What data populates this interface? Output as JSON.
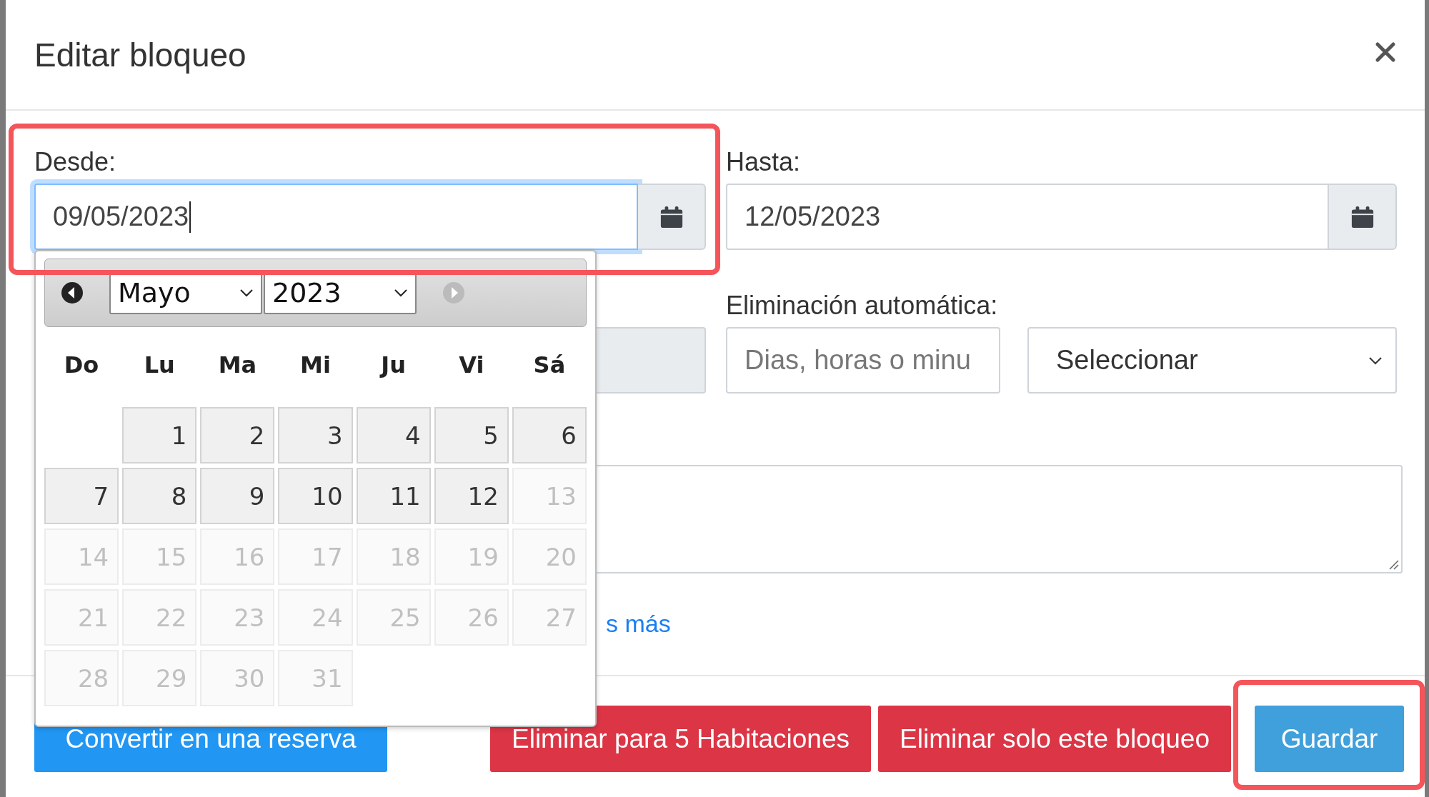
{
  "dialog": {
    "title": "Editar bloqueo"
  },
  "date_fields": [
    {
      "label": "Desde:",
      "value": "09/05/2023",
      "focused": true,
      "highlighted": true
    },
    {
      "label": "Hasta:",
      "value": "12/05/2023",
      "focused": false,
      "highlighted": false
    }
  ],
  "auto_delete": {
    "label": "Eliminación automática:",
    "amount": {
      "placeholder": "Dias, horas o minu"
    },
    "unit": {
      "value": "Seleccionar"
    }
  },
  "link": {
    "text": "s más"
  },
  "datepicker": {
    "month": "Mayo",
    "year": "2023",
    "prev_disabled": false,
    "next_disabled": true,
    "weekdays": [
      "Do",
      "Lu",
      "Ma",
      "Mi",
      "Ju",
      "Vi",
      "Sá"
    ],
    "weeks": [
      [
        {
          "day": "1",
          "disabled": false
        },
        {
          "day": "2",
          "disabled": false
        },
        {
          "day": "3",
          "disabled": false
        },
        {
          "day": "4",
          "disabled": false
        },
        {
          "day": "5",
          "disabled": false
        },
        {
          "day": "6",
          "disabled": false
        }
      ],
      [
        {
          "day": "7",
          "disabled": false
        },
        {
          "day": "8",
          "disabled": false
        },
        {
          "day": "9",
          "disabled": false
        },
        {
          "day": "10",
          "disabled": false
        },
        {
          "day": "11",
          "disabled": false
        },
        {
          "day": "12",
          "disabled": false
        },
        {
          "day": "13",
          "disabled": true
        }
      ],
      [
        {
          "day": "14",
          "disabled": true
        },
        {
          "day": "15",
          "disabled": true
        },
        {
          "day": "16",
          "disabled": true
        },
        {
          "day": "17",
          "disabled": true
        },
        {
          "day": "18",
          "disabled": true
        },
        {
          "day": "19",
          "disabled": true
        },
        {
          "day": "20",
          "disabled": true
        }
      ],
      [
        {
          "day": "21",
          "disabled": true
        },
        {
          "day": "22",
          "disabled": true
        },
        {
          "day": "23",
          "disabled": true
        },
        {
          "day": "24",
          "disabled": true
        },
        {
          "day": "25",
          "disabled": true
        },
        {
          "day": "26",
          "disabled": true
        },
        {
          "day": "27",
          "disabled": true
        }
      ],
      [
        {
          "day": "28",
          "disabled": true
        },
        {
          "day": "29",
          "disabled": true
        },
        {
          "day": "30",
          "disabled": true
        },
        {
          "day": "31",
          "disabled": true
        }
      ]
    ]
  },
  "buttons": [
    {
      "label": "Convertir en una reserva",
      "kind": "primary",
      "highlighted": false
    },
    {
      "label": "Eliminar para 5 Habitaciones",
      "kind": "danger",
      "highlighted": false
    },
    {
      "label": "Eliminar solo este bloqueo",
      "kind": "danger",
      "highlighted": false
    },
    {
      "label": "Guardar",
      "kind": "save",
      "highlighted": true
    }
  ]
}
